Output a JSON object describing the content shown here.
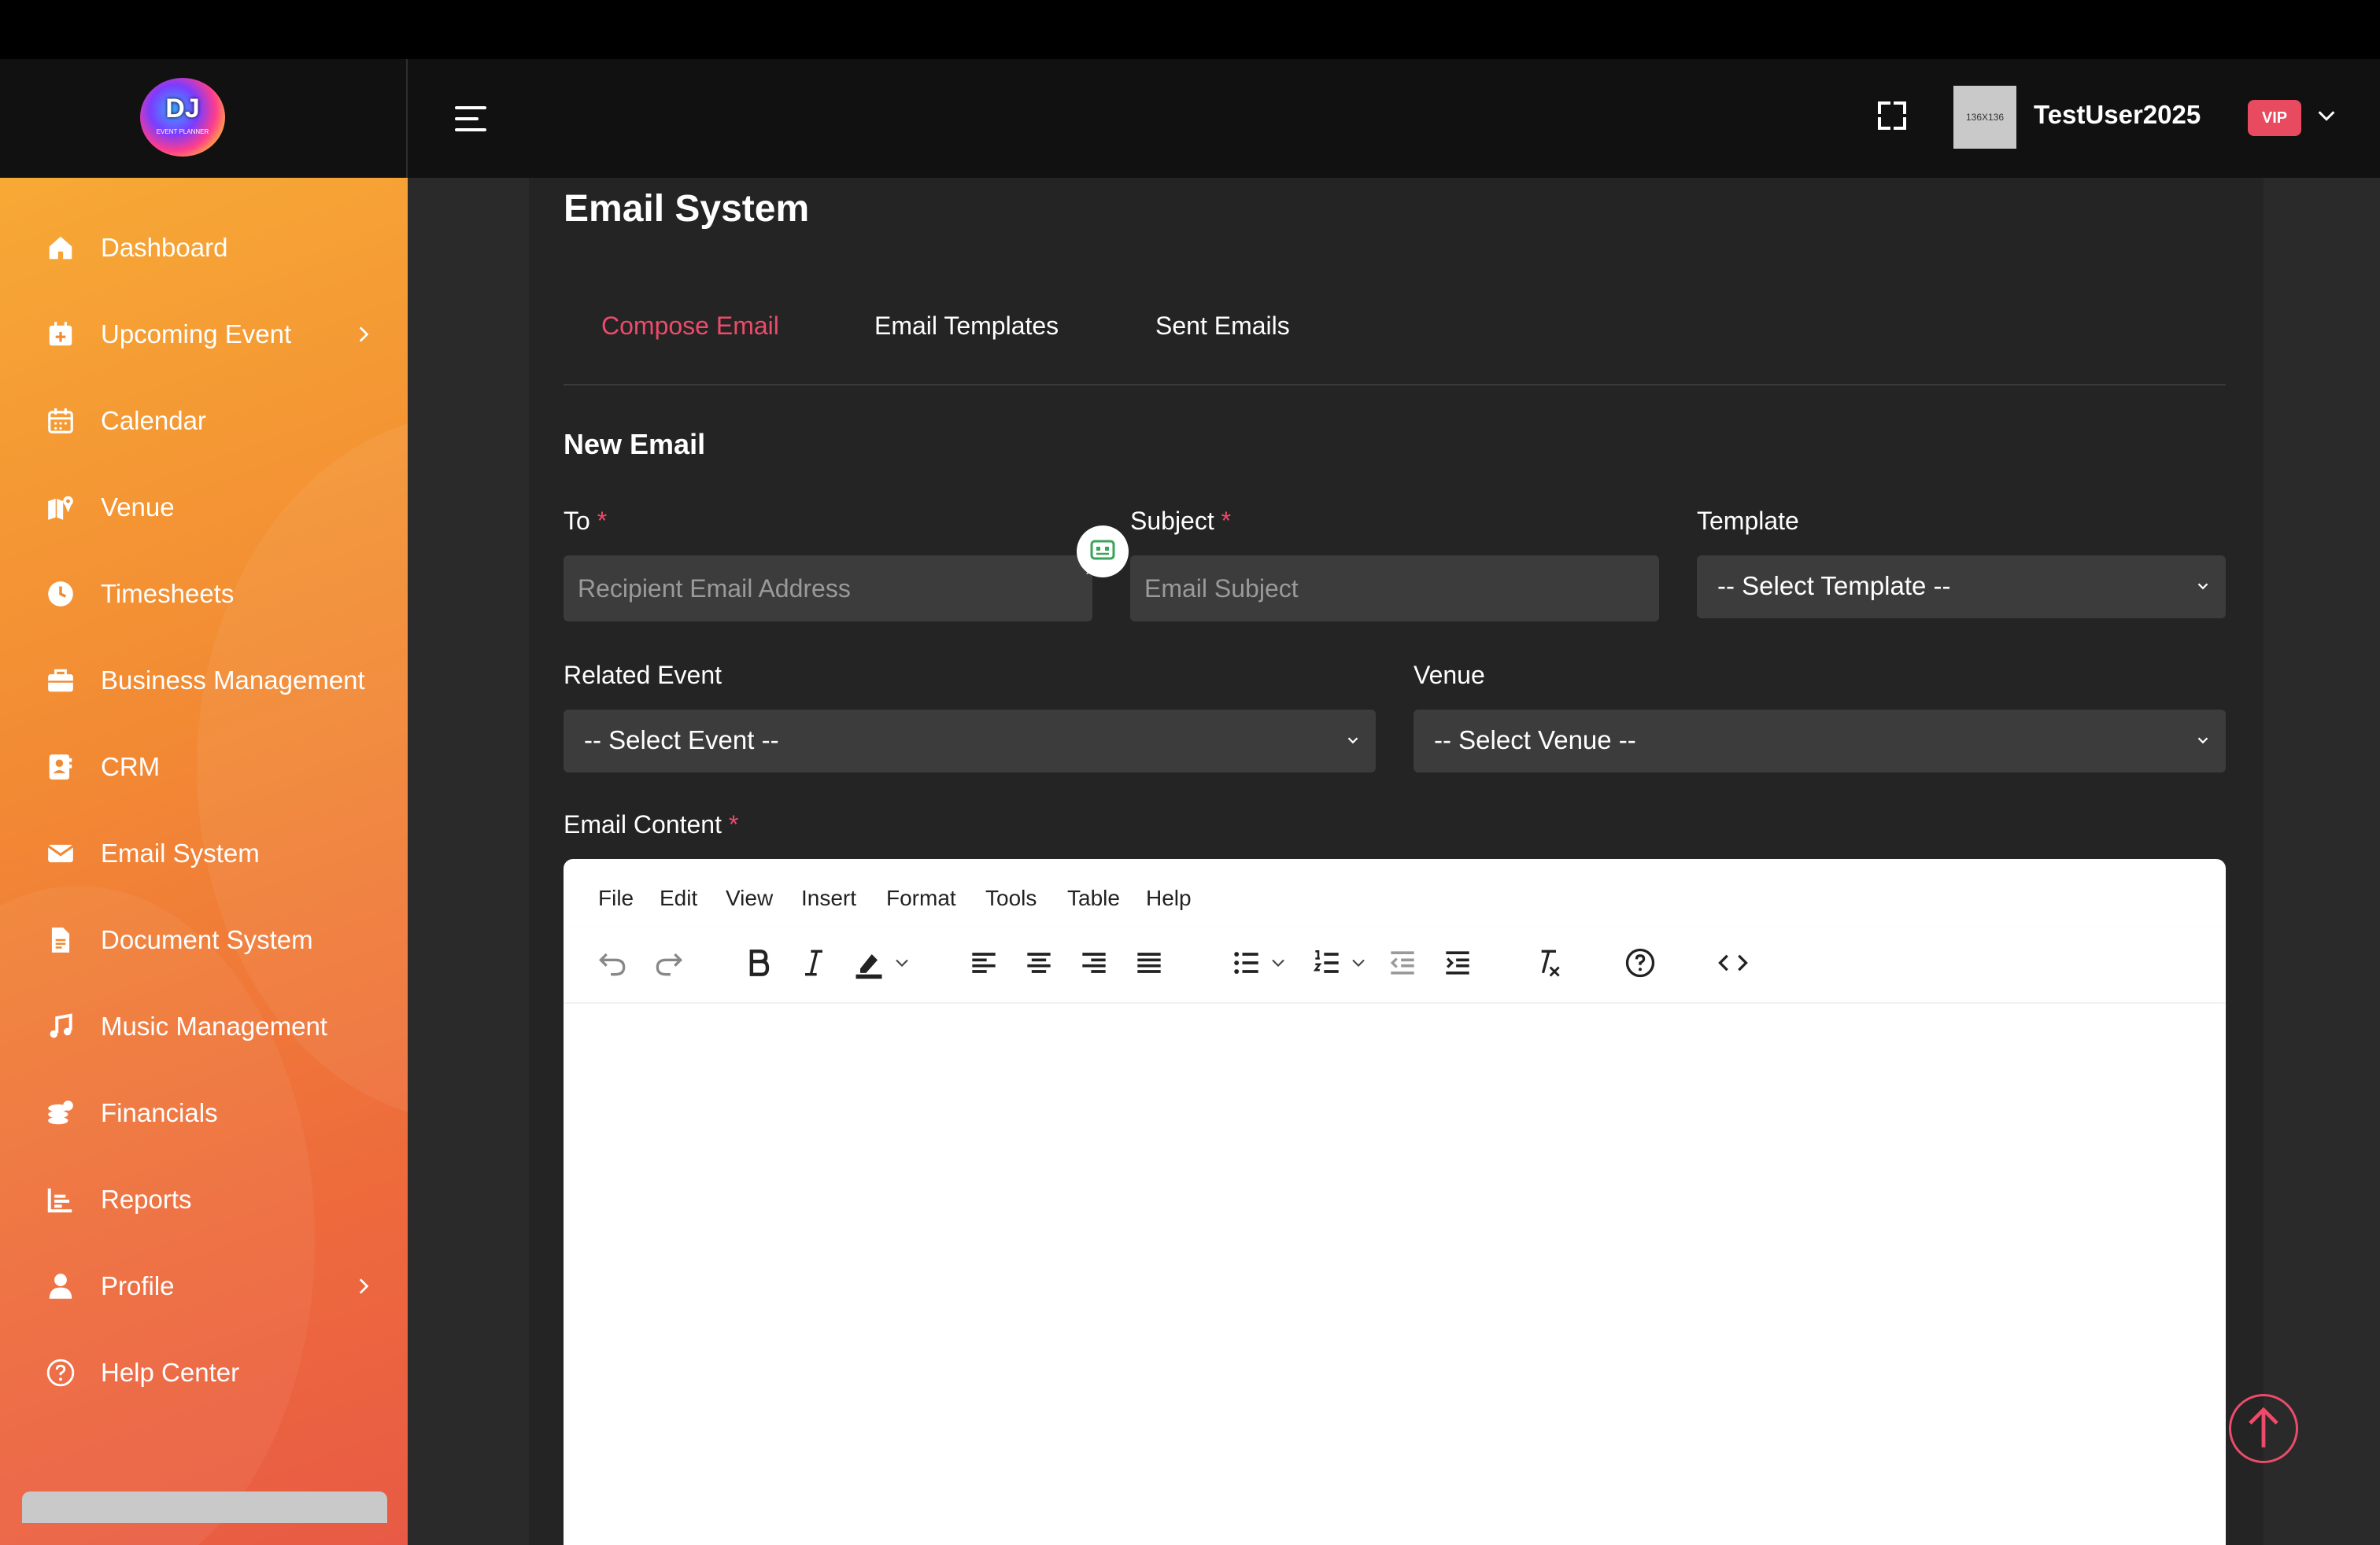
{
  "app": {
    "logo_text": "DJ",
    "logo_sub": "EVENT PLANNER"
  },
  "header": {
    "avatar_text": "136X136",
    "username": "TestUser2025",
    "badge": "VIP"
  },
  "sidebar": {
    "items": [
      {
        "label": "Dashboard"
      },
      {
        "label": "Upcoming Event"
      },
      {
        "label": "Calendar"
      },
      {
        "label": "Venue"
      },
      {
        "label": "Timesheets"
      },
      {
        "label": "Business Management"
      },
      {
        "label": "CRM"
      },
      {
        "label": "Email System"
      },
      {
        "label": "Document System"
      },
      {
        "label": "Music Management"
      },
      {
        "label": "Financials"
      },
      {
        "label": "Reports"
      },
      {
        "label": "Profile"
      },
      {
        "label": "Help Center"
      }
    ]
  },
  "page": {
    "title": "Email System"
  },
  "tabs": [
    {
      "label": "Compose Email"
    },
    {
      "label": "Email Templates"
    },
    {
      "label": "Sent Emails"
    }
  ],
  "form": {
    "section_title": "New Email",
    "required_mark": "*",
    "to": {
      "label": "To",
      "placeholder": "Recipient Email Address"
    },
    "subject": {
      "label": "Subject",
      "placeholder": "Email Subject"
    },
    "template": {
      "label": "Template",
      "value": "-- Select Template --"
    },
    "event": {
      "label": "Related Event",
      "value": "-- Select Event --"
    },
    "venue": {
      "label": "Venue",
      "value": "-- Select Venue --"
    },
    "content": {
      "label": "Email Content"
    }
  },
  "editor": {
    "menu": [
      "File",
      "Edit",
      "View",
      "Insert",
      "Format",
      "Tools",
      "Table",
      "Help"
    ]
  },
  "colors": {
    "accent": "#ec4b6a",
    "sidebar_start": "#f7a935",
    "sidebar_end": "#e85a45",
    "badge": "#e84a5f"
  }
}
